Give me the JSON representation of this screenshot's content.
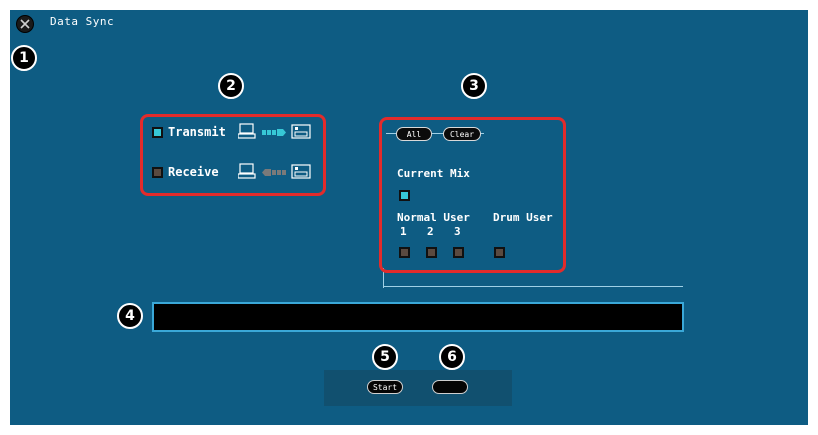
{
  "window": {
    "title": "Data Sync"
  },
  "callouts": [
    "1",
    "2",
    "3",
    "4",
    "5",
    "6"
  ],
  "direction": {
    "transmit_label": "Transmit",
    "receive_label": "Receive",
    "transmit_checked": true,
    "receive_checked": false
  },
  "targets": {
    "all_label": "All",
    "clear_label": "Clear",
    "current_mix_label": "Current Mix",
    "normal_user_label": "Normal User",
    "drum_user_label": "Drum User",
    "user_numbers": [
      "1",
      "2",
      "3"
    ]
  },
  "message": "",
  "footer": {
    "start_label": "Start",
    "second_label": ""
  },
  "colors": {
    "background": "#0e5c83",
    "highlight": "#e32b2b",
    "accent": "#37c8d6"
  }
}
